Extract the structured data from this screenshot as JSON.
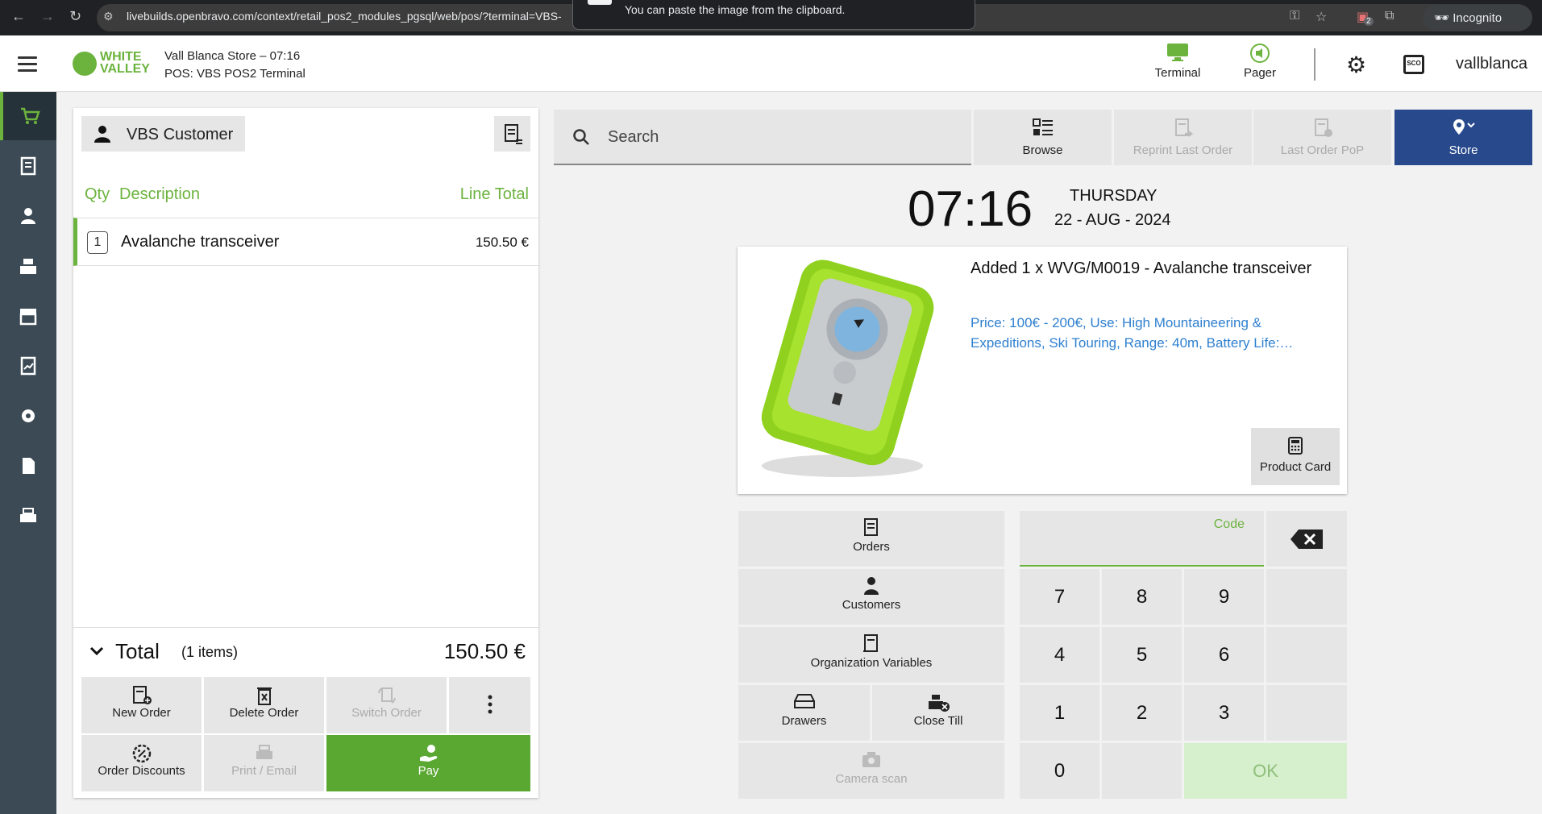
{
  "browser": {
    "url": "livebuilds.openbravo.com/context/retail_pos2_modules_pgsql/web/pos/?terminal=VBS-",
    "tooltip": "You can paste the image from the clipboard.",
    "ext_badge": "2",
    "incognito_label": "Incognito"
  },
  "header": {
    "logo_line1": "WHITE",
    "logo_line2": "VALLEY",
    "store_line": "Vall Blanca Store – 07:16",
    "terminal_line": "POS: VBS POS2 Terminal",
    "terminal_btn": "Terminal",
    "pager_btn": "Pager",
    "sco_label": "SCO",
    "username": "vallblanca"
  },
  "sidebar": {
    "items": [
      "cart-icon",
      "receipt-icon",
      "person-icon",
      "cash-register-icon",
      "store-icon",
      "report-icon",
      "gear-icon",
      "document-icon",
      "printer-icon"
    ]
  },
  "ticket": {
    "customer": "VBS Customer",
    "col_qty": "Qty",
    "col_desc": "Description",
    "col_total": "Line Total",
    "lines": [
      {
        "qty": "1",
        "description": "Avalanche transceiver",
        "total": "150.50 €"
      }
    ],
    "total_label": "Total",
    "total_items": "(1 items)",
    "total_amount": "150.50 €",
    "buttons": {
      "new_order": "New Order",
      "delete_order": "Delete Order",
      "switch_order": "Switch Order",
      "order_discounts": "Order Discounts",
      "print_email": "Print / Email",
      "pay": "Pay"
    }
  },
  "main": {
    "search_placeholder": "Search",
    "browse": "Browse",
    "reprint_last_order": "Reprint Last Order",
    "last_order_pop": "Last Order PoP",
    "store": "Store",
    "clock": "07:16",
    "day": "THURSDAY",
    "date": "22 - AUG - 2024",
    "product_added": "Added 1 x WVG/M0019 - Avalanche transceiver",
    "product_desc": "Price: 100€ - 200€, Use: High Mountaineering & Expeditions, Ski Touring, Range: 40m, Battery Life:…",
    "product_card": "Product Card",
    "orders": "Orders",
    "customers": "Customers",
    "org_vars": "Organization Variables",
    "drawers": "Drawers",
    "close_till": "Close Till",
    "camera_scan": "Camera scan",
    "code_label": "Code",
    "keys": [
      "7",
      "8",
      "9",
      "4",
      "5",
      "6",
      "1",
      "2",
      "3",
      "0"
    ],
    "ok": "OK"
  }
}
